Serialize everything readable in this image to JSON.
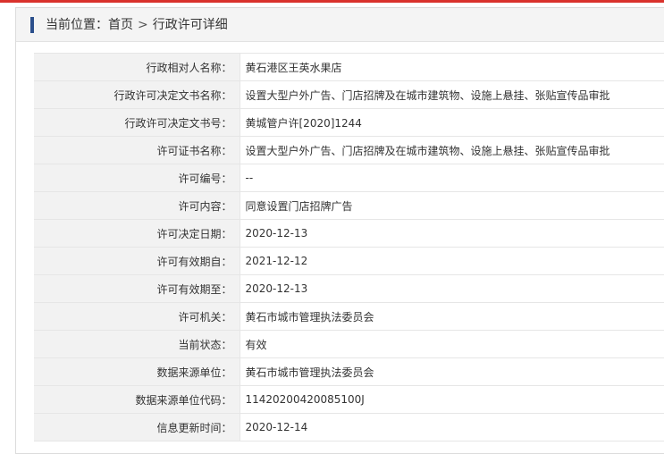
{
  "breadcrumb": {
    "prefix": "当前位置：",
    "home": "首页",
    "separator": ">",
    "current": "行政许可详细"
  },
  "rows": [
    {
      "label": "行政相对人名称：",
      "value": "黄石港区王英水果店"
    },
    {
      "label": "行政许可决定文书名称：",
      "value": "设置大型户外广告、门店招牌及在城市建筑物、设施上悬挂、张贴宣传品审批"
    },
    {
      "label": "行政许可决定文书号：",
      "value": "黄城管户许[2020]1244"
    },
    {
      "label": "许可证书名称：",
      "value": "设置大型户外广告、门店招牌及在城市建筑物、设施上悬挂、张贴宣传品审批"
    },
    {
      "label": "许可编号：",
      "value": "--"
    },
    {
      "label": "许可内容：",
      "value": "同意设置门店招牌广告"
    },
    {
      "label": "许可决定日期：",
      "value": "2020-12-13"
    },
    {
      "label": "许可有效期自：",
      "value": "2021-12-12"
    },
    {
      "label": "许可有效期至：",
      "value": "2020-12-13"
    },
    {
      "label": "许可机关：",
      "value": "黄石市城市管理执法委员会"
    },
    {
      "label": "当前状态：",
      "value": "有效"
    },
    {
      "label": "数据来源单位：",
      "value": "黄石市城市管理执法委员会"
    },
    {
      "label": "数据来源单位代码：",
      "value": "11420200420085100J"
    },
    {
      "label": "信息更新时间：",
      "value": "2020-12-14"
    }
  ],
  "colors": {
    "accent_marker": "#2b4f8c",
    "top_rule": "#d9322c",
    "label_bg": "#f2f2f2"
  }
}
